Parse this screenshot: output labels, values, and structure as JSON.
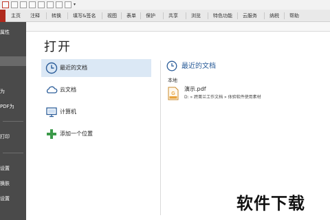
{
  "ribbon": {
    "tabs": [
      "主页",
      "注释",
      "转换",
      "填写&签名",
      "视图",
      "表单",
      "保护",
      "共享",
      "浏览",
      "特色功能",
      "云服务",
      "纳税",
      "帮助"
    ]
  },
  "left_menu": {
    "items": [
      "属性",
      "为",
      "PDF为",
      "打印",
      "设置",
      "换肤",
      "设置"
    ]
  },
  "open_page": {
    "heading": "打开",
    "locations": [
      "最近的文档",
      "云文档",
      "计算机",
      "添加一个位置"
    ]
  },
  "recent": {
    "title": "最近的文档",
    "group_label": "本地",
    "files": [
      {
        "name": "演示.pdf",
        "path": "D: » 跨菁兰工作文档 » 体验软件使用素材"
      }
    ]
  },
  "watermark": "软件下载",
  "colors": {
    "accent": "#2b5d99",
    "file_tab": "#b02a1d",
    "selected": "#dbe8f5",
    "pdf_icon": "#e8a33c"
  }
}
